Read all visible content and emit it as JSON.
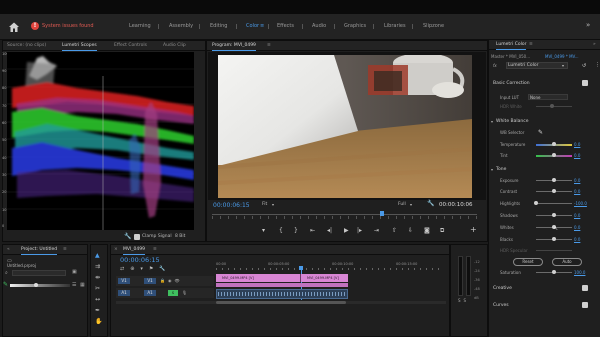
{
  "topbar": {
    "warning": "System issues found",
    "workspaces": [
      "Learning",
      "Assembly",
      "Editing",
      "Color",
      "Effects",
      "Audio",
      "Graphics",
      "Libraries",
      "Slipzone"
    ],
    "active_workspace": "Color"
  },
  "source_panel": {
    "tabs": [
      "Source: (no clips)",
      "Lumetri Scopes",
      "Effect Controls",
      "Audio Clip"
    ],
    "y_labels": [
      "100",
      "90",
      "80",
      "70",
      "60",
      "50",
      "40",
      "30",
      "20",
      "10",
      "0"
    ],
    "clamp_label": "Clamp Signal",
    "bit_depth": "8 Bit"
  },
  "program": {
    "title": "Program: MVI_0499",
    "timecode": "00:00:06:15",
    "fit": "Fit",
    "quality": "Full",
    "duration": "00:00:10:06"
  },
  "lumetri": {
    "tab": "Lumetri Color",
    "master": "Master * MVI_050...",
    "clip": "MVI_0499 * MV...",
    "fx_label": "fx",
    "effect_name": "Lumetri Color",
    "basic_correction": "Basic Correction",
    "input_lut_label": "Input LUT",
    "input_lut_value": "None",
    "hdr_white": "HDR White",
    "white_balance": "White Balance",
    "wb_selector": "WB Selector",
    "temperature_label": "Temperature",
    "temperature_value": "0.0",
    "tint_label": "Tint",
    "tint_value": "0.0",
    "tone": "Tone",
    "exposure_label": "Exposure",
    "exposure_value": "0.0",
    "contrast_label": "Contrast",
    "contrast_value": "0.0",
    "highlights_label": "Highlights",
    "highlights_value": "-100.0",
    "shadows_label": "Shadows",
    "shadows_value": "0.0",
    "whites_label": "Whites",
    "whites_value": "0.0",
    "blacks_label": "Blacks",
    "blacks_value": "0.0",
    "hdr_specular": "HDR Specular",
    "reset_button": "Reset",
    "auto_button": "Auto",
    "saturation_label": "Saturation",
    "saturation_value": "100.0",
    "creative": "Creative",
    "curves": "Curves"
  },
  "project": {
    "title": "Project: Untitled",
    "file": "Untitled.prproj"
  },
  "timeline": {
    "title": "MVI_0499",
    "timecode": "00:00:06:15",
    "ruler": [
      "00:00",
      "00:00:05:00",
      "00:00:10:00",
      "00:00:15:00"
    ],
    "clip_label": "MVI_0499.MP4 [V]",
    "clip_label_2": "MVI_0499.MP4 [V]",
    "track_v1": "V1",
    "track_a1": "A1"
  },
  "meter": {
    "labels": [
      "-12",
      "-24",
      "-36",
      "-48",
      "dB"
    ]
  }
}
